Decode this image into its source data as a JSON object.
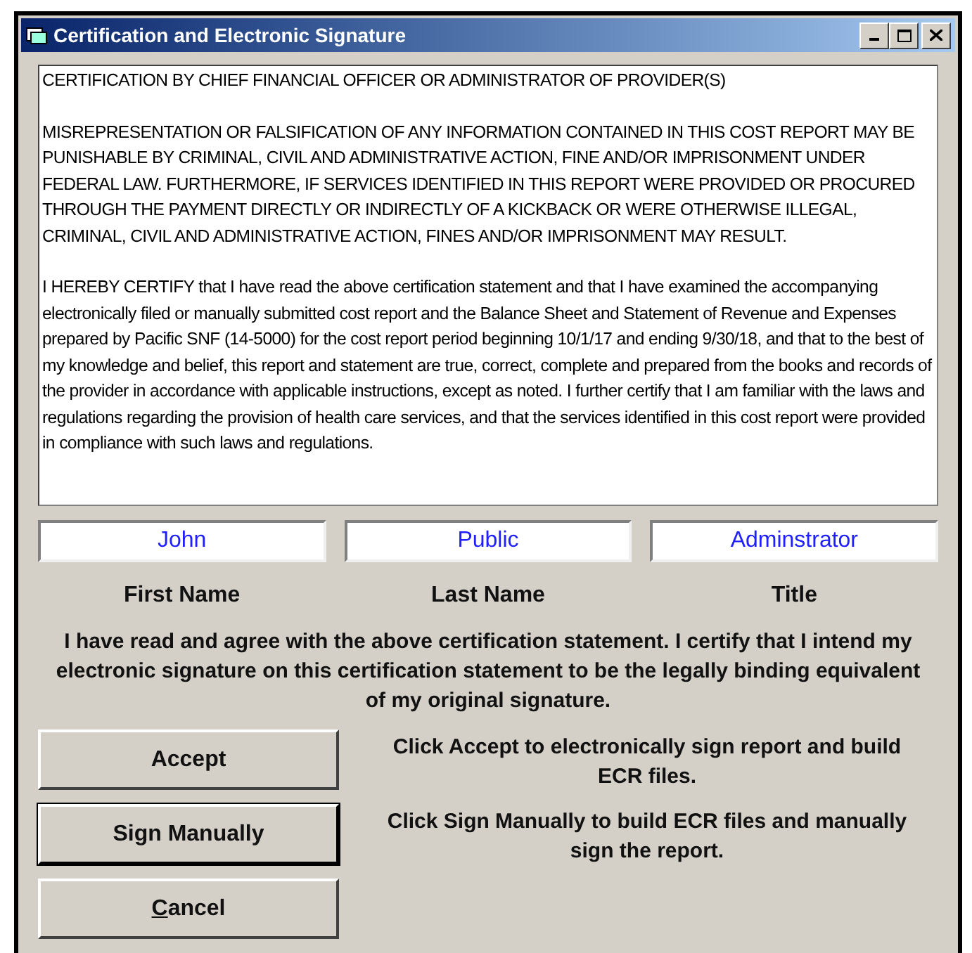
{
  "window": {
    "title": "Certification and Electronic Signature"
  },
  "certification_text": [
    "CERTIFICATION BY CHIEF FINANCIAL OFFICER OR ADMINISTRATOR OF PROVIDER(S)",
    "MISREPRESENTATION OR FALSIFICATION OF ANY INFORMATION CONTAINED IN THIS COST REPORT MAY BE PUNISHABLE BY CRIMINAL, CIVIL AND ADMINISTRATIVE ACTION, FINE AND/OR IMPRISONMENT UNDER FEDERAL LAW. FURTHERMORE, IF SERVICES IDENTIFIED IN THIS REPORT WERE PROVIDED OR PROCURED THROUGH THE PAYMENT DIRECTLY OR INDIRECTLY OF A KICKBACK OR WERE OTHERWISE ILLEGAL, CRIMINAL, CIVIL AND ADMINISTRATIVE ACTION, FINES AND/OR IMPRISONMENT MAY RESULT.",
    "I HEREBY CERTIFY that I have read the above certification statement and that I have examined the accompanying electronically filed or manually submitted cost report and the Balance Sheet and Statement of Revenue and Expenses prepared by Pacific SNF (14-5000) for the cost report period beginning 10/1/17 and ending 9/30/18, and that to the best of my knowledge and belief, this report and statement are true, correct, complete and prepared from the books and records of the provider in accordance with applicable instructions, except as noted. I further certify that I am familiar with the laws and regulations regarding the provision of health care services, and that the services identified in this cost report were provided in compliance with such laws and regulations."
  ],
  "fields": [
    {
      "label": "First Name",
      "value": "John"
    },
    {
      "label": "Last Name",
      "value": "Public"
    },
    {
      "label": "Title",
      "value": "Adminstrator"
    }
  ],
  "agreement": "I have read and agree with the above certification statement. I certify that I intend my electronic signature on this certification statement to be the legally binding equivalent of my original signature.",
  "actions": [
    {
      "label": "Accept",
      "default": false,
      "access_key": false,
      "description": "Click Accept to electronically sign report and build ECR files."
    },
    {
      "label": "Sign Manually",
      "default": true,
      "access_key": false,
      "description": "Click Sign Manually to build ECR files and manually sign the report."
    },
    {
      "label": "Cancel",
      "default": false,
      "access_key": true
    }
  ]
}
